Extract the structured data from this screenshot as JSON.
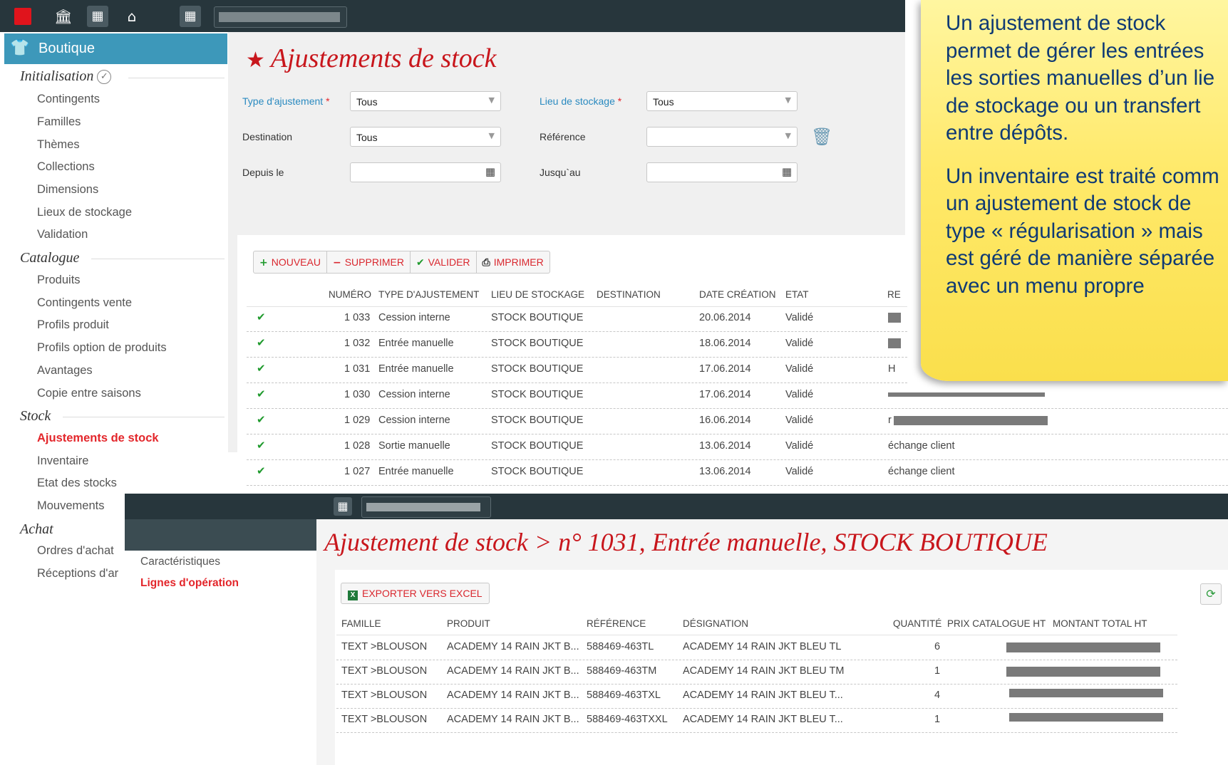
{
  "topbar": {
    "icons": [
      "stop-icon",
      "bank-icon",
      "building-icon",
      "home-icon",
      "building-icon"
    ]
  },
  "sidebar": {
    "module": "Boutique",
    "sections": [
      {
        "title": "Initialisation",
        "items": [
          "Contingents",
          "Familles",
          "Thèmes",
          "Collections",
          "Dimensions",
          "Lieux de stockage",
          "Validation"
        ]
      },
      {
        "title": "Catalogue",
        "items": [
          "Produits",
          "Contingents vente",
          "Profils produit",
          "Profils option de produits",
          "Avantages",
          "Copie entre saisons"
        ]
      },
      {
        "title": "Stock",
        "items": [
          "Ajustements de stock",
          "Inventaire",
          "Etat des stocks",
          "Mouvements"
        ]
      },
      {
        "title": "Achat",
        "items": [
          "Ordres d'achat",
          "Réceptions d'ar"
        ]
      }
    ],
    "active_item": "Ajustements de stock"
  },
  "main": {
    "title": "Ajustements de stock",
    "filters": {
      "type_label": "Type d'ajustement",
      "type_value": "Tous",
      "lieu_label": "Lieu de stockage",
      "lieu_value": "Tous",
      "destination_label": "Destination",
      "destination_value": "Tous",
      "reference_label": "Référence",
      "reference_value": "",
      "depuis_label": "Depuis le",
      "jusqu_label": "Jusqu`au"
    },
    "toolbar": {
      "nouveau": "NOUVEAU",
      "supprimer": "SUPPRIMER",
      "valider": "VALIDER",
      "imprimer": "IMPRIMER"
    },
    "columns": [
      "NUMÉRO",
      "TYPE D'AJUSTEMENT",
      "LIEU DE STOCKAGE",
      "DESTINATION",
      "DATE CRÉATION",
      "ETAT",
      "RE"
    ],
    "rows": [
      {
        "numero": "1 033",
        "type": "Cession interne",
        "lieu": "STOCK BOUTIQUE",
        "date": "20.06.2014",
        "etat": "Validé",
        "ref": ""
      },
      {
        "numero": "1 032",
        "type": "Entrée manuelle",
        "lieu": "STOCK BOUTIQUE",
        "date": "18.06.2014",
        "etat": "Validé",
        "ref": ""
      },
      {
        "numero": "1 031",
        "type": "Entrée manuelle",
        "lieu": "STOCK BOUTIQUE",
        "date": "17.06.2014",
        "etat": "Validé",
        "ref": "H"
      },
      {
        "numero": "1 030",
        "type": "Cession interne",
        "lieu": "STOCK BOUTIQUE",
        "date": "17.06.2014",
        "etat": "Validé",
        "ref": ""
      },
      {
        "numero": "1 029",
        "type": "Cession interne",
        "lieu": "STOCK BOUTIQUE",
        "date": "16.06.2014",
        "etat": "Validé",
        "ref": "r"
      },
      {
        "numero": "1 028",
        "type": "Sortie manuelle",
        "lieu": "STOCK BOUTIQUE",
        "date": "13.06.2014",
        "etat": "Validé",
        "ref": "échange client"
      },
      {
        "numero": "1 027",
        "type": "Entrée manuelle",
        "lieu": "STOCK BOUTIQUE",
        "date": "13.06.2014",
        "etat": "Validé",
        "ref": "échange client"
      }
    ]
  },
  "note": {
    "p1": "Un ajustement de stock\npermet de gérer les entrées\nles sorties manuelles d’un lie\nde stockage ou un transfert\nentre dépôts.",
    "p2": "Un inventaire est traité comm\nun ajustement de stock de\ntype « régularisation » mais\nest géré de manière séparée\navec un menu propre"
  },
  "detail": {
    "title": "Ajustement de stock > n° 1031, Entrée manuelle, STOCK BOUTIQUE",
    "tabs": [
      "Caractéristiques",
      "Lignes d'opération"
    ],
    "active_tab": "Lignes d'opération",
    "export_label": "EXPORTER VERS EXCEL",
    "columns": [
      "FAMILLE",
      "PRODUIT",
      "RÉFÉRENCE",
      "DÉSIGNATION",
      "QUANTITÉ",
      "PRIX CATALOGUE HT",
      "MONTANT TOTAL HT"
    ],
    "rows": [
      {
        "famille": "TEXT >BLOUSON",
        "produit": "ACADEMY 14 RAIN JKT B...",
        "reference": "588469-463TL",
        "designation": "ACADEMY 14 RAIN JKT BLEU TL",
        "quantite": "6"
      },
      {
        "famille": "TEXT >BLOUSON",
        "produit": "ACADEMY 14 RAIN JKT B...",
        "reference": "588469-463TM",
        "designation": "ACADEMY 14 RAIN JKT BLEU TM",
        "quantite": "1"
      },
      {
        "famille": "TEXT >BLOUSON",
        "produit": "ACADEMY 14 RAIN JKT B...",
        "reference": "588469-463TXL",
        "designation": "ACADEMY 14 RAIN JKT BLEU T...",
        "quantite": "4"
      },
      {
        "famille": "TEXT >BLOUSON",
        "produit": "ACADEMY 14 RAIN JKT B...",
        "reference": "588469-463TXXL",
        "designation": "ACADEMY 14 RAIN JKT BLEU T...",
        "quantite": "1"
      }
    ]
  }
}
